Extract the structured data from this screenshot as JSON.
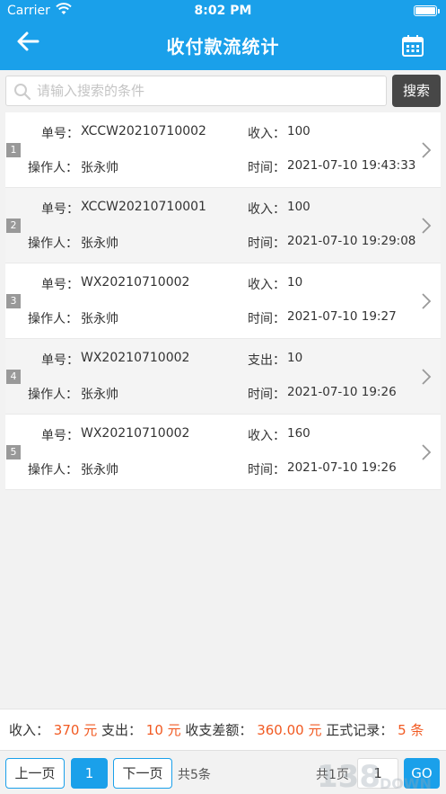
{
  "status_bar": {
    "carrier": "Carrier",
    "time": "8:02 PM"
  },
  "header": {
    "title": "收付款流统计",
    "back_icon": "arrow-left-icon",
    "calendar_icon": "calendar-icon"
  },
  "search": {
    "placeholder": "请输入搜索的条件",
    "value": "",
    "button_label": "搜索"
  },
  "labels": {
    "order_no": "单号：",
    "operator": "操作人：",
    "time": "时间："
  },
  "records": [
    {
      "index": "1",
      "order_no": "XCCW20210710002",
      "operator": "张永帅",
      "amount_label": "收入：",
      "amount": "100",
      "time": "2021-07-10 19:43:33"
    },
    {
      "index": "2",
      "order_no": "XCCW20210710001",
      "operator": "张永帅",
      "amount_label": "收入：",
      "amount": "100",
      "time": "2021-07-10 19:29:08"
    },
    {
      "index": "3",
      "order_no": "WX20210710002",
      "operator": "张永帅",
      "amount_label": "收入：",
      "amount": "10",
      "time": "2021-07-10 19:27"
    },
    {
      "index": "4",
      "order_no": "WX20210710002",
      "operator": "张永帅",
      "amount_label": "支出：",
      "amount": "10",
      "time": "2021-07-10 19:26"
    },
    {
      "index": "5",
      "order_no": "WX20210710002",
      "operator": "张永帅",
      "amount_label": "收入：",
      "amount": "160",
      "time": "2021-07-10 19:26"
    }
  ],
  "summary": {
    "income_label": "收入：",
    "income_value": "370 元",
    "expense_label": "支出：",
    "expense_value": "10 元",
    "diff_label": "收支差额：",
    "diff_value": "360.00 元",
    "count_label": "正式记录：",
    "count_value": "5 条"
  },
  "pager": {
    "prev_label": "上一页",
    "current_page": "1",
    "next_label": "下一页",
    "total_items": "共5条",
    "total_pages": "共1页",
    "page_input": "1",
    "go_label": "GO"
  },
  "colors": {
    "primary": "#1aa0ea",
    "accent_red": "#f15a22",
    "search_btn": "#474747"
  },
  "watermark": {
    "text": "138DOWN"
  }
}
